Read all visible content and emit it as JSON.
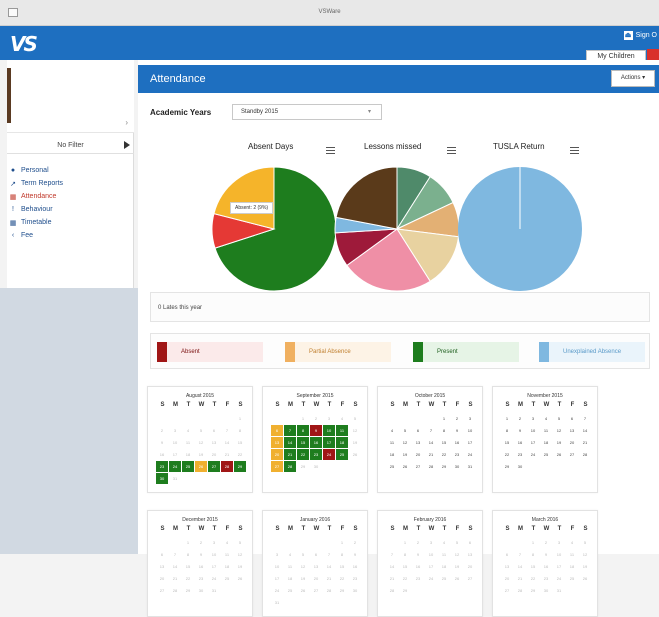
{
  "window": {
    "title": "VSWare"
  },
  "header": {
    "logo": "VS",
    "signout": "Sign O",
    "my_children": "My Children"
  },
  "sidebar": {
    "filter_label": "No Filter",
    "items": [
      {
        "label": "Personal",
        "icon": "person-icon"
      },
      {
        "label": "Term Reports",
        "icon": "chart-icon"
      },
      {
        "label": "Attendance",
        "icon": "calendar-icon",
        "active": true
      },
      {
        "label": "Behaviour",
        "icon": "exclamation-icon"
      },
      {
        "label": "Timetable",
        "icon": "calendar-icon"
      },
      {
        "label": "Fee",
        "icon": "back-icon"
      }
    ]
  },
  "main": {
    "title": "Attendance",
    "actions_label": "Actions",
    "academic_years_label": "Academic Years",
    "academic_year_value": "Standby 2015",
    "lates_text": "0 Lates this year"
  },
  "charts": {
    "tooltip": "Absent: 2 (9%)"
  },
  "chart_data": [
    {
      "type": "pie",
      "title": "Absent Days",
      "slices": [
        {
          "value": 70,
          "color": "#1e7d1e"
        },
        {
          "value": 9,
          "color": "#e53935"
        },
        {
          "value": 21,
          "color": "#f5b42a"
        }
      ]
    },
    {
      "type": "pie",
      "title": "Lessons missed",
      "slices": [
        {
          "value": 9,
          "color": "#4f8a6a"
        },
        {
          "value": 9,
          "color": "#7bb08e"
        },
        {
          "value": 9,
          "color": "#e3b074"
        },
        {
          "value": 14,
          "color": "#e8d2a0"
        },
        {
          "value": 24,
          "color": "#ef8fa6"
        },
        {
          "value": 9,
          "color": "#9e1a3a"
        },
        {
          "value": 4,
          "color": "#7fb8e0"
        },
        {
          "value": 22,
          "color": "#5a3a1a"
        }
      ]
    },
    {
      "type": "pie",
      "title": "TUSLA Return",
      "slices": [
        {
          "value": 100,
          "color": "#7fb8e0"
        }
      ]
    }
  ],
  "legend": [
    {
      "label": "Absent",
      "color": "#a01616",
      "bg": "#fbeaea"
    },
    {
      "label": "Partial Absence",
      "color": "#f0b060",
      "bg": "#fdf3e6"
    },
    {
      "label": "Present",
      "color": "#1e7d1e",
      "bg": "#e6f4e6"
    },
    {
      "label": "Unexplained Absence",
      "color": "#7fb8e0",
      "bg": "#eaf4fb"
    }
  ],
  "calendar": {
    "weekdays": [
      "S",
      "M",
      "T",
      "W",
      "T",
      "F",
      "S"
    ],
    "months": [
      {
        "name": "August 2015",
        "offset": 6,
        "days": 31,
        "marks": {
          "23": "p",
          "24": "p",
          "25": "p",
          "26": "r",
          "27": "p",
          "28": "a",
          "29": "p",
          "30": "p"
        }
      },
      {
        "name": "September 2015",
        "offset": 2,
        "days": 30,
        "marks": {
          "6": "r",
          "7": "p",
          "8": "p",
          "9": "a",
          "10": "p",
          "11": "p",
          "13": "r",
          "14": "p",
          "15": "p",
          "16": "p",
          "17": "p",
          "18": "p",
          "20": "r",
          "21": "p",
          "22": "p",
          "23": "p",
          "24": "a",
          "25": "p",
          "27": "r",
          "28": "p"
        }
      },
      {
        "name": "October 2015",
        "offset": 4,
        "days": 31,
        "marks": {}
      },
      {
        "name": "November 2015",
        "offset": 0,
        "days": 30,
        "marks": {}
      },
      {
        "name": "December 2015",
        "offset": 2,
        "days": 31,
        "marks": {}
      },
      {
        "name": "January 2016",
        "offset": 5,
        "days": 31,
        "marks": {}
      },
      {
        "name": "February 2016",
        "offset": 1,
        "days": 29,
        "marks": {}
      },
      {
        "name": "March 2016",
        "offset": 2,
        "days": 31,
        "marks": {}
      }
    ]
  }
}
